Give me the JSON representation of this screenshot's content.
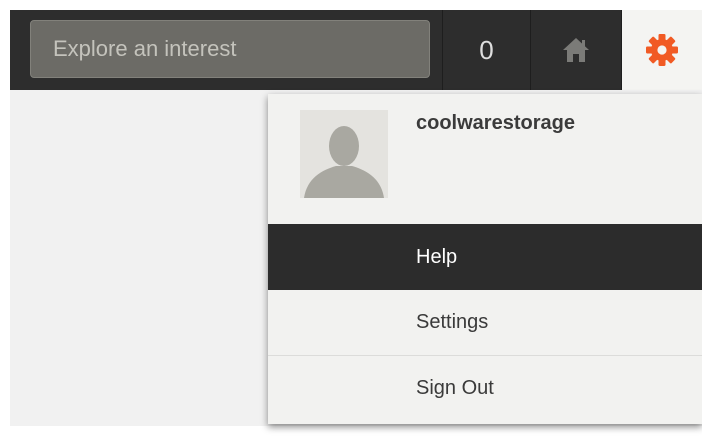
{
  "topbar": {
    "search": {
      "placeholder": "Explore an interest",
      "value": ""
    },
    "notification_count": "0",
    "home_icon": "home-icon",
    "settings_icon": "gear-icon"
  },
  "dropdown": {
    "username": "coolwarestorage",
    "avatar_icon": "default-avatar-icon",
    "items": [
      {
        "label": "Help",
        "highlighted": true
      },
      {
        "label": "Settings",
        "highlighted": false
      },
      {
        "label": "Sign Out",
        "highlighted": false
      }
    ]
  },
  "colors": {
    "topbar_bg": "#2d2d2d",
    "accent_orange": "#f15a24",
    "highlight_bg": "#2c2c2c",
    "menu_bg": "#f2f2f0"
  }
}
